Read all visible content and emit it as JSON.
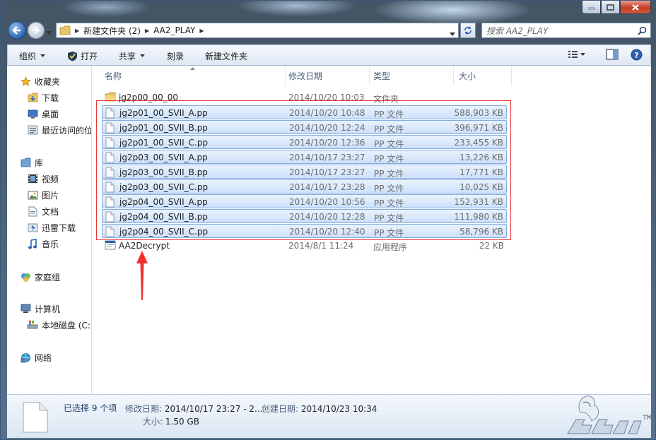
{
  "address": {
    "crumbs": [
      "新建文件夹 (2)",
      "AA2_PLAY"
    ],
    "search_placeholder": "搜索 AA2_PLAY"
  },
  "toolbar": {
    "organize": "组织",
    "open": "打开",
    "share": "共享",
    "burn": "刻录",
    "new_folder": "新建文件夹"
  },
  "nav": {
    "favorites": "收藏夹",
    "downloads": "下载",
    "desktop": "桌面",
    "recent": "最近访问的位置",
    "libraries": "库",
    "videos": "视频",
    "pictures": "图片",
    "documents": "文档",
    "thunder": "迅雷下载",
    "music": "音乐",
    "homegroup": "家庭组",
    "computer": "计算机",
    "local_disk": "本地磁盘 (C:)",
    "network": "网络"
  },
  "columns": {
    "name": "名称",
    "modified": "修改日期",
    "type": "类型",
    "size": "大小"
  },
  "files": [
    {
      "name": "jg2p00_00_00",
      "date": "2014/10/20 10:03",
      "type": "文件夹",
      "size": "",
      "kind": "folder",
      "selected": false
    },
    {
      "name": "jg2p01_00_SVII_A.pp",
      "date": "2014/10/20 10:48",
      "type": "PP 文件",
      "size": "588,903 KB",
      "kind": "file",
      "selected": true
    },
    {
      "name": "jg2p01_00_SVII_B.pp",
      "date": "2014/10/20 12:24",
      "type": "PP 文件",
      "size": "396,971 KB",
      "kind": "file",
      "selected": true
    },
    {
      "name": "jg2p01_00_SVII_C.pp",
      "date": "2014/10/20 12:36",
      "type": "PP 文件",
      "size": "233,455 KB",
      "kind": "file",
      "selected": true
    },
    {
      "name": "jg2p03_00_SVII_A.pp",
      "date": "2014/10/17 23:27",
      "type": "PP 文件",
      "size": "13,226 KB",
      "kind": "file",
      "selected": true
    },
    {
      "name": "jg2p03_00_SVII_B.pp",
      "date": "2014/10/17 23:27",
      "type": "PP 文件",
      "size": "17,771 KB",
      "kind": "file",
      "selected": true
    },
    {
      "name": "jg2p03_00_SVII_C.pp",
      "date": "2014/10/17 23:28",
      "type": "PP 文件",
      "size": "10,025 KB",
      "kind": "file",
      "selected": true
    },
    {
      "name": "jg2p04_00_SVII_A.pp",
      "date": "2014/10/20 10:56",
      "type": "PP 文件",
      "size": "152,931 KB",
      "kind": "file",
      "selected": true
    },
    {
      "name": "jg2p04_00_SVII_B.pp",
      "date": "2014/10/20 12:28",
      "type": "PP 文件",
      "size": "111,980 KB",
      "kind": "file",
      "selected": true
    },
    {
      "name": "jg2p04_00_SVII_C.pp",
      "date": "2014/10/20 12:40",
      "type": "PP 文件",
      "size": "58,796 KB",
      "kind": "file",
      "selected": true
    },
    {
      "name": "AA2Decrypt",
      "date": "2014/8/1 11:24",
      "type": "应用程序",
      "size": "22 KB",
      "kind": "app",
      "selected": false
    }
  ],
  "details": {
    "selected_count": "已选择 9 个项",
    "modified_label": "修改日期:",
    "modified_value": "2014/10/17 23:27 - 2...",
    "created_label": "创建日期:",
    "created_value": "2014/10/23 10:34",
    "size_label": "大小:",
    "size_value": "1.50 GB"
  },
  "colors": {
    "selection_border": "#84acdd",
    "annotation_red": "#e23a3a"
  }
}
